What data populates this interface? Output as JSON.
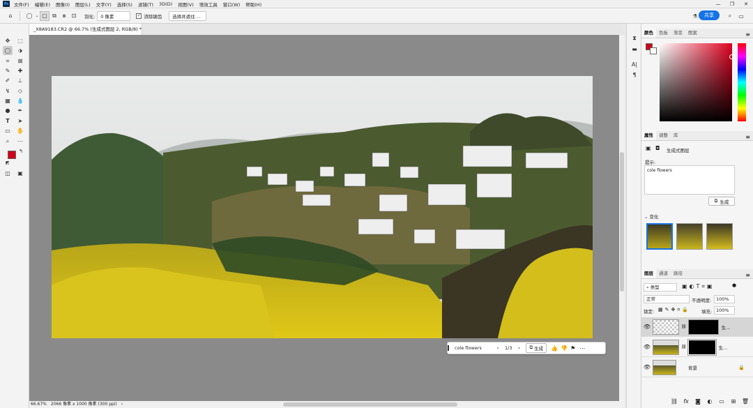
{
  "app": {
    "logo": "Ps"
  },
  "menu": [
    "文件(F)",
    "编辑(E)",
    "图像(I)",
    "图层(L)",
    "文字(Y)",
    "选择(S)",
    "滤镜(T)",
    "3D(D)",
    "视图(V)",
    "增效工具",
    "窗口(W)",
    "帮助(H)"
  ],
  "options": {
    "feather_label": "羽化:",
    "feather_value": "0 像素",
    "antialias_label": "消除锯齿",
    "select_mask_label": "选择并遮住 ...",
    "share_label": "共享"
  },
  "document": {
    "tab_title": "_X8A9183.CR2 @ 66.7% (生成式图层 2, RGB/8) *",
    "zoom": "66.67%",
    "info": "2066 像素 x 1000 像素 (300 ppi)"
  },
  "generation_bar": {
    "prompt": "cole flowers",
    "counter": "1/3",
    "generate_label": "生成"
  },
  "color_panel": {
    "tabs": [
      "颜色",
      "色板",
      "渐变",
      "图案"
    ],
    "foreground": "#d0001a",
    "background": "#ffffff"
  },
  "properties_panel": {
    "tabs": [
      "属性",
      "调整",
      "库"
    ],
    "layer_type": "生成式图层",
    "prompt_label": "提示:",
    "prompt_value": "cole flowers",
    "generate_label": "生成",
    "variations_label": "变化"
  },
  "layers_panel": {
    "tabs": [
      "图层",
      "通道",
      "路径"
    ],
    "filter_label": "类型",
    "blend_mode": "正常",
    "opacity_label": "不透明度:",
    "opacity_value": "100%",
    "lock_label": "锁定:",
    "fill_label": "填充:",
    "fill_value": "100%",
    "layers": [
      {
        "name": "生..."
      },
      {
        "name": "生..."
      },
      {
        "name": "背景"
      }
    ]
  }
}
